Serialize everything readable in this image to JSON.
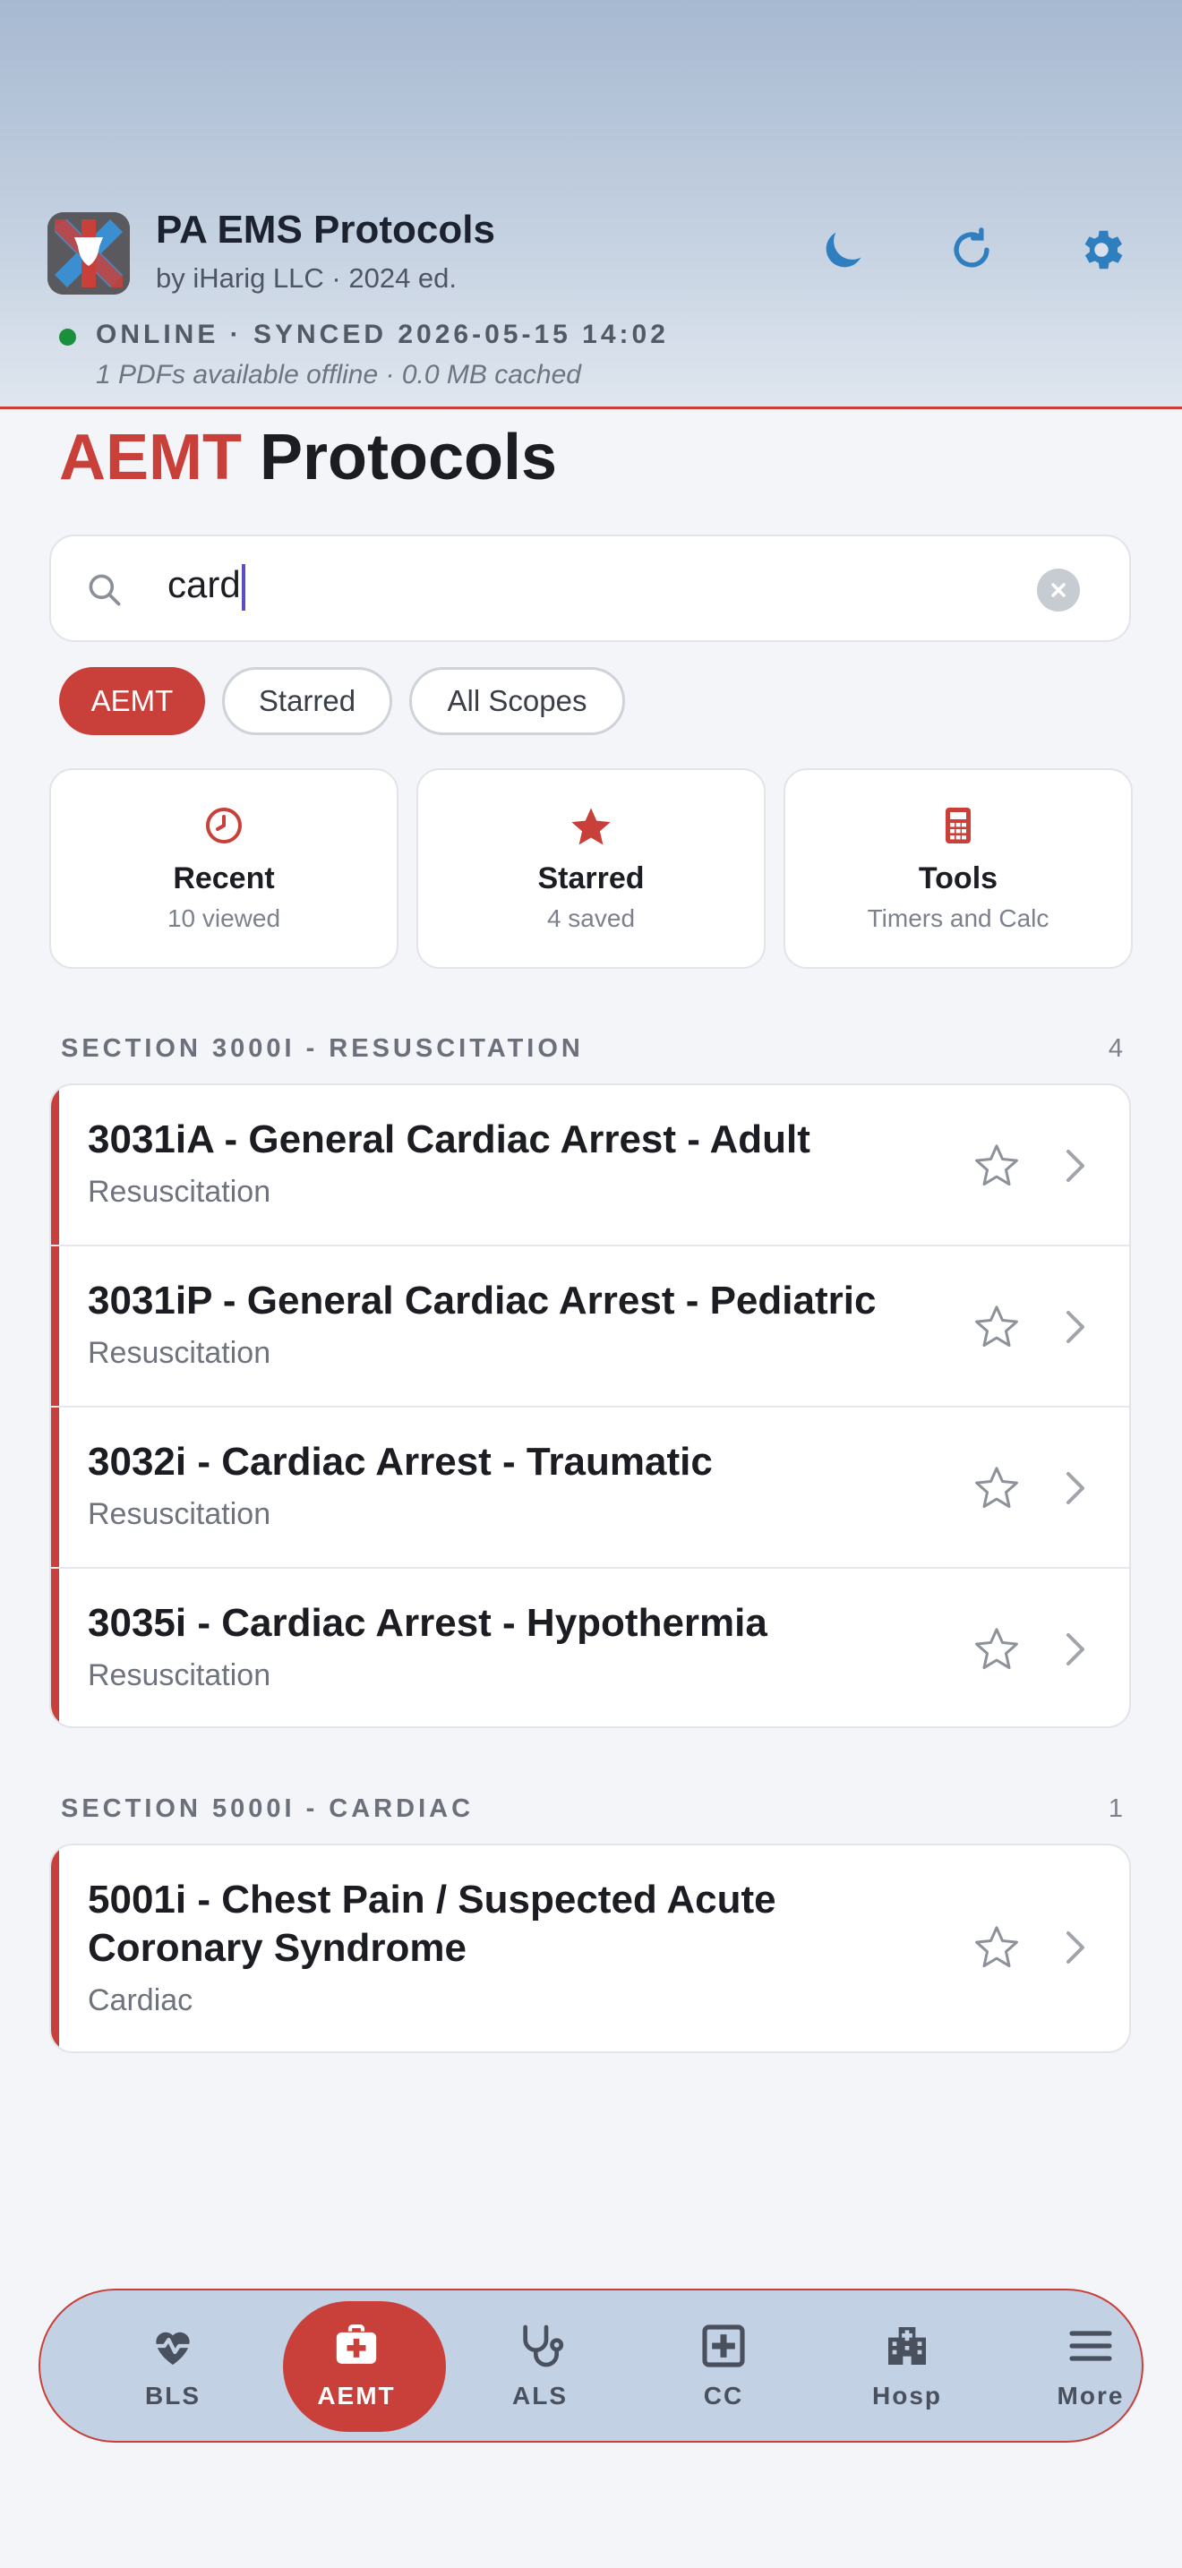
{
  "header": {
    "app_title": "PA EMS Protocols",
    "app_subtitle": "by iHarig LLC · 2024 ed.",
    "status": "ONLINE · SYNCED 2026-05-15 14:02",
    "offline_info": "1 PDFs available offline · 0.0 MB cached",
    "actions": [
      "moon-icon",
      "refresh-icon",
      "gear-icon"
    ]
  },
  "page": {
    "scope": "AEMT",
    "title_rest": "Protocols"
  },
  "search": {
    "value": "card",
    "placeholder": ""
  },
  "chips": [
    "AEMT",
    "Starred",
    "All Scopes"
  ],
  "quick": [
    {
      "title": "Recent",
      "sub": "10 viewed",
      "icon": "clock-icon"
    },
    {
      "title": "Starred",
      "sub": "4 saved",
      "icon": "star-icon"
    },
    {
      "title": "Tools",
      "sub": "Timers and Calc",
      "icon": "calculator-icon"
    }
  ],
  "sections": [
    {
      "title": "SECTION 3000I - RESUSCITATION",
      "count": "4",
      "items": [
        {
          "title": "3031iA - General Cardiac Arrest - Adult",
          "sub": "Resuscitation"
        },
        {
          "title": "3031iP - General Cardiac Arrest - Pediatric",
          "sub": "Resuscitation"
        },
        {
          "title": "3032i - Cardiac Arrest - Traumatic",
          "sub": "Resuscitation"
        },
        {
          "title": "3035i - Cardiac Arrest - Hypothermia",
          "sub": "Resuscitation"
        }
      ]
    },
    {
      "title": "SECTION 5000I - CARDIAC",
      "count": "1",
      "items": [
        {
          "title": "5001i - Chest Pain / Suspected Acute Coronary Syndrome",
          "sub": "Cardiac"
        }
      ]
    }
  ],
  "tabs": [
    {
      "label": "BLS",
      "icon": "heart-pulse-icon"
    },
    {
      "label": "AEMT",
      "icon": "medical-bag-icon",
      "active": true
    },
    {
      "label": "ALS",
      "icon": "stethoscope-icon"
    },
    {
      "label": "CC",
      "icon": "medical-cross-icon"
    },
    {
      "label": "Hosp",
      "icon": "hospital-icon"
    },
    {
      "label": "More",
      "icon": "menu-icon"
    }
  ],
  "colors": {
    "accent": "#c9403a",
    "online": "#1a8f3c",
    "header_icon": "#2f7fc0"
  }
}
